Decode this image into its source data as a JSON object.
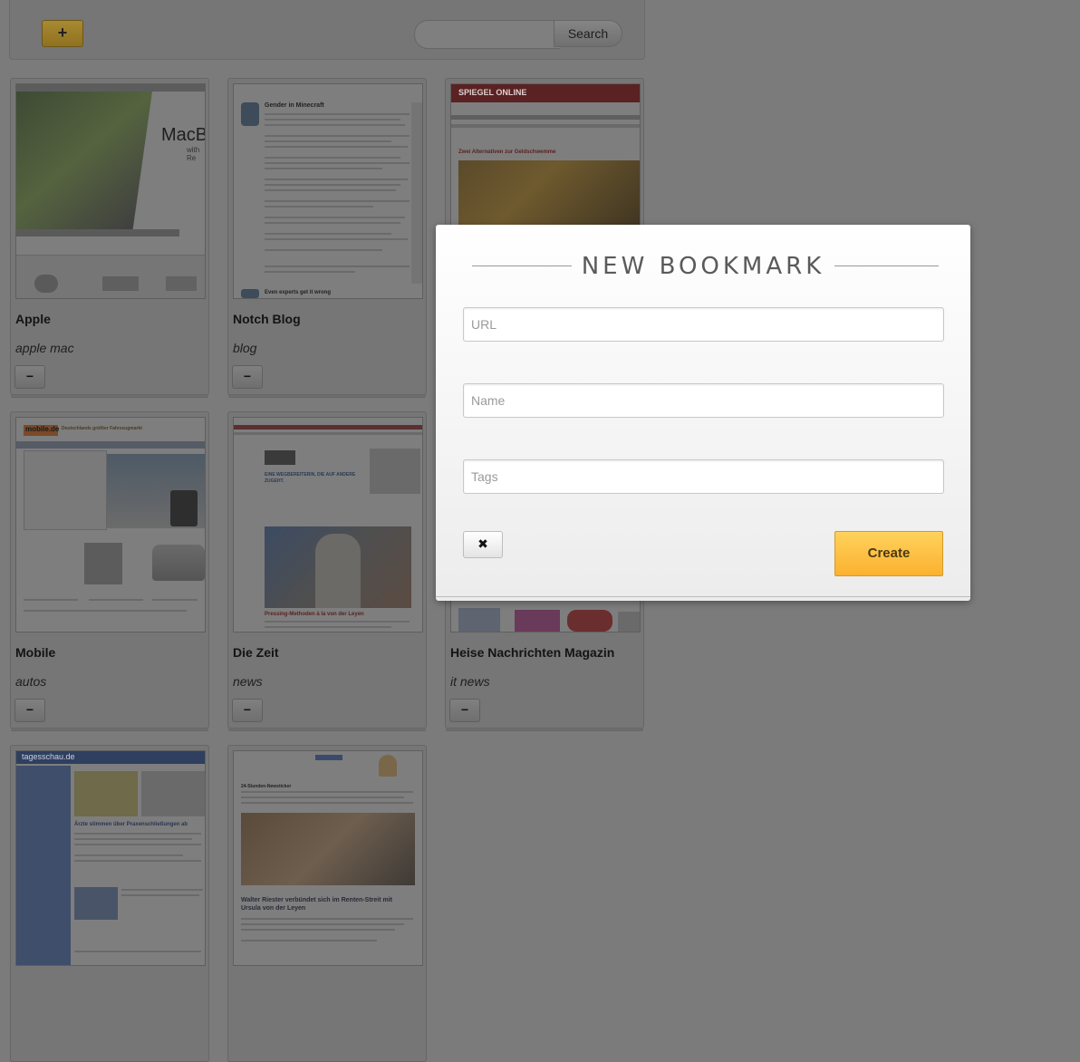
{
  "toolbar": {
    "add_label": "+",
    "search_placeholder": "",
    "search_label": "Search"
  },
  "bookmarks": [
    {
      "name": "Apple",
      "tags": "apple mac",
      "remove_label": "−"
    },
    {
      "name": "Notch Blog",
      "tags": "blog",
      "remove_label": "−"
    },
    {
      "name": "",
      "tags": "",
      "remove_label": ""
    },
    {
      "name": "Mobile",
      "tags": "autos",
      "remove_label": "−"
    },
    {
      "name": "Die Zeit",
      "tags": "news",
      "remove_label": "−"
    },
    {
      "name": "Heise Nachrichten Magazin",
      "tags": "it news",
      "remove_label": "−"
    },
    {
      "name": "",
      "tags": "",
      "remove_label": ""
    },
    {
      "name": "",
      "tags": "",
      "remove_label": ""
    }
  ],
  "thumbnails": {
    "apple": {
      "headline": "MacBo",
      "sub": "with Re"
    },
    "notch": {
      "headline": "Gender in Minecraft",
      "footer": "Even experts get it wrong"
    },
    "spiegel": {
      "brand": "SPIEGEL ONLINE",
      "headline": "Zwei Alternativen zur Geldschwemme"
    },
    "mobile": {
      "brand": "mobile.de",
      "tagline": "Deutschlands größter Fahrzeugmarkt"
    },
    "zeit": {
      "headline": "Pressing-Methoden à la von der Leyen",
      "ad": "EINE WEGBEREITERIN, DIE AUF ANDERE ZUGEHT."
    },
    "tagesschau": {
      "brand": "tagesschau.de",
      "headline": "Ärzte stimmen über Praxenschließungen ab"
    },
    "focus": {
      "headline": "Walter Riester verbündet sich im Renten-Streit mit Ursula von der Leyen",
      "kicker": "24-Stunden-Newsticker"
    }
  },
  "modal": {
    "title": "NEW BOOKMARK",
    "url_placeholder": "URL",
    "name_placeholder": "Name",
    "tags_placeholder": "Tags",
    "close_label": "✖",
    "create_label": "Create"
  },
  "colors": {
    "overlay": "#7b7b7b",
    "accent": "#fbb12f",
    "modal_bg": "#ffffff"
  }
}
